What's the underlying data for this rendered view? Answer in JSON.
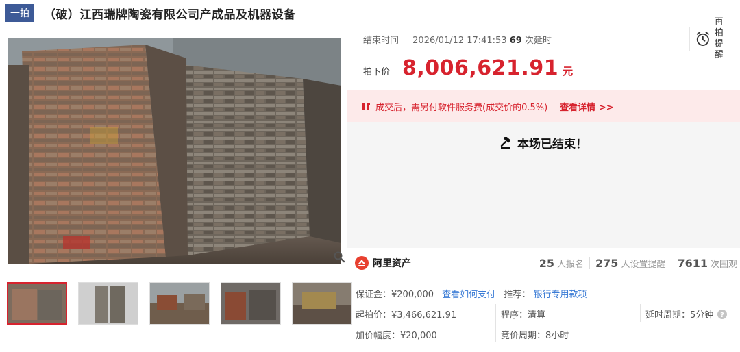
{
  "header": {
    "round_tag": "一拍",
    "title": "（破）江西瑞牌陶瓷有限公司产成品及机器设备"
  },
  "auction": {
    "end_time_label": "结束时间",
    "end_time": "2026/01/12 17:41:53",
    "delay_count": "69",
    "delay_suffix": "次延时",
    "reminder_label": "再拍提醒",
    "price_label": "拍下价",
    "price": "8,006,621.91",
    "currency_unit": "元",
    "notice_text": "成交后，需另付软件服务费(成交价的0.5%)",
    "notice_link": "查看详情 >>",
    "ended_text": "本场已结束！"
  },
  "brand": {
    "name": "阿里资产"
  },
  "stats": {
    "registrants": "25",
    "registrants_label": "人报名",
    "reminders": "275",
    "reminders_label": "人设置提醒",
    "views": "7611",
    "views_label": "次围观"
  },
  "details": {
    "deposit": "保证金：¥200,000",
    "deposit_link": "查看如何支付",
    "recommend_label": "推荐：",
    "recommend_link": "银行专用款项",
    "start_price": "起拍价：¥3,466,621.91",
    "procedure": "程序：清算",
    "delay_period": "延时周期：5分钟",
    "increment": "加价幅度：¥20,000",
    "bid_period": "竞价周期：8小时"
  },
  "colors": {
    "accent_red": "#d7232e",
    "tag_blue": "#3d5a97",
    "link_blue": "#3a7bd5",
    "notice_bg": "#fdeaea"
  }
}
